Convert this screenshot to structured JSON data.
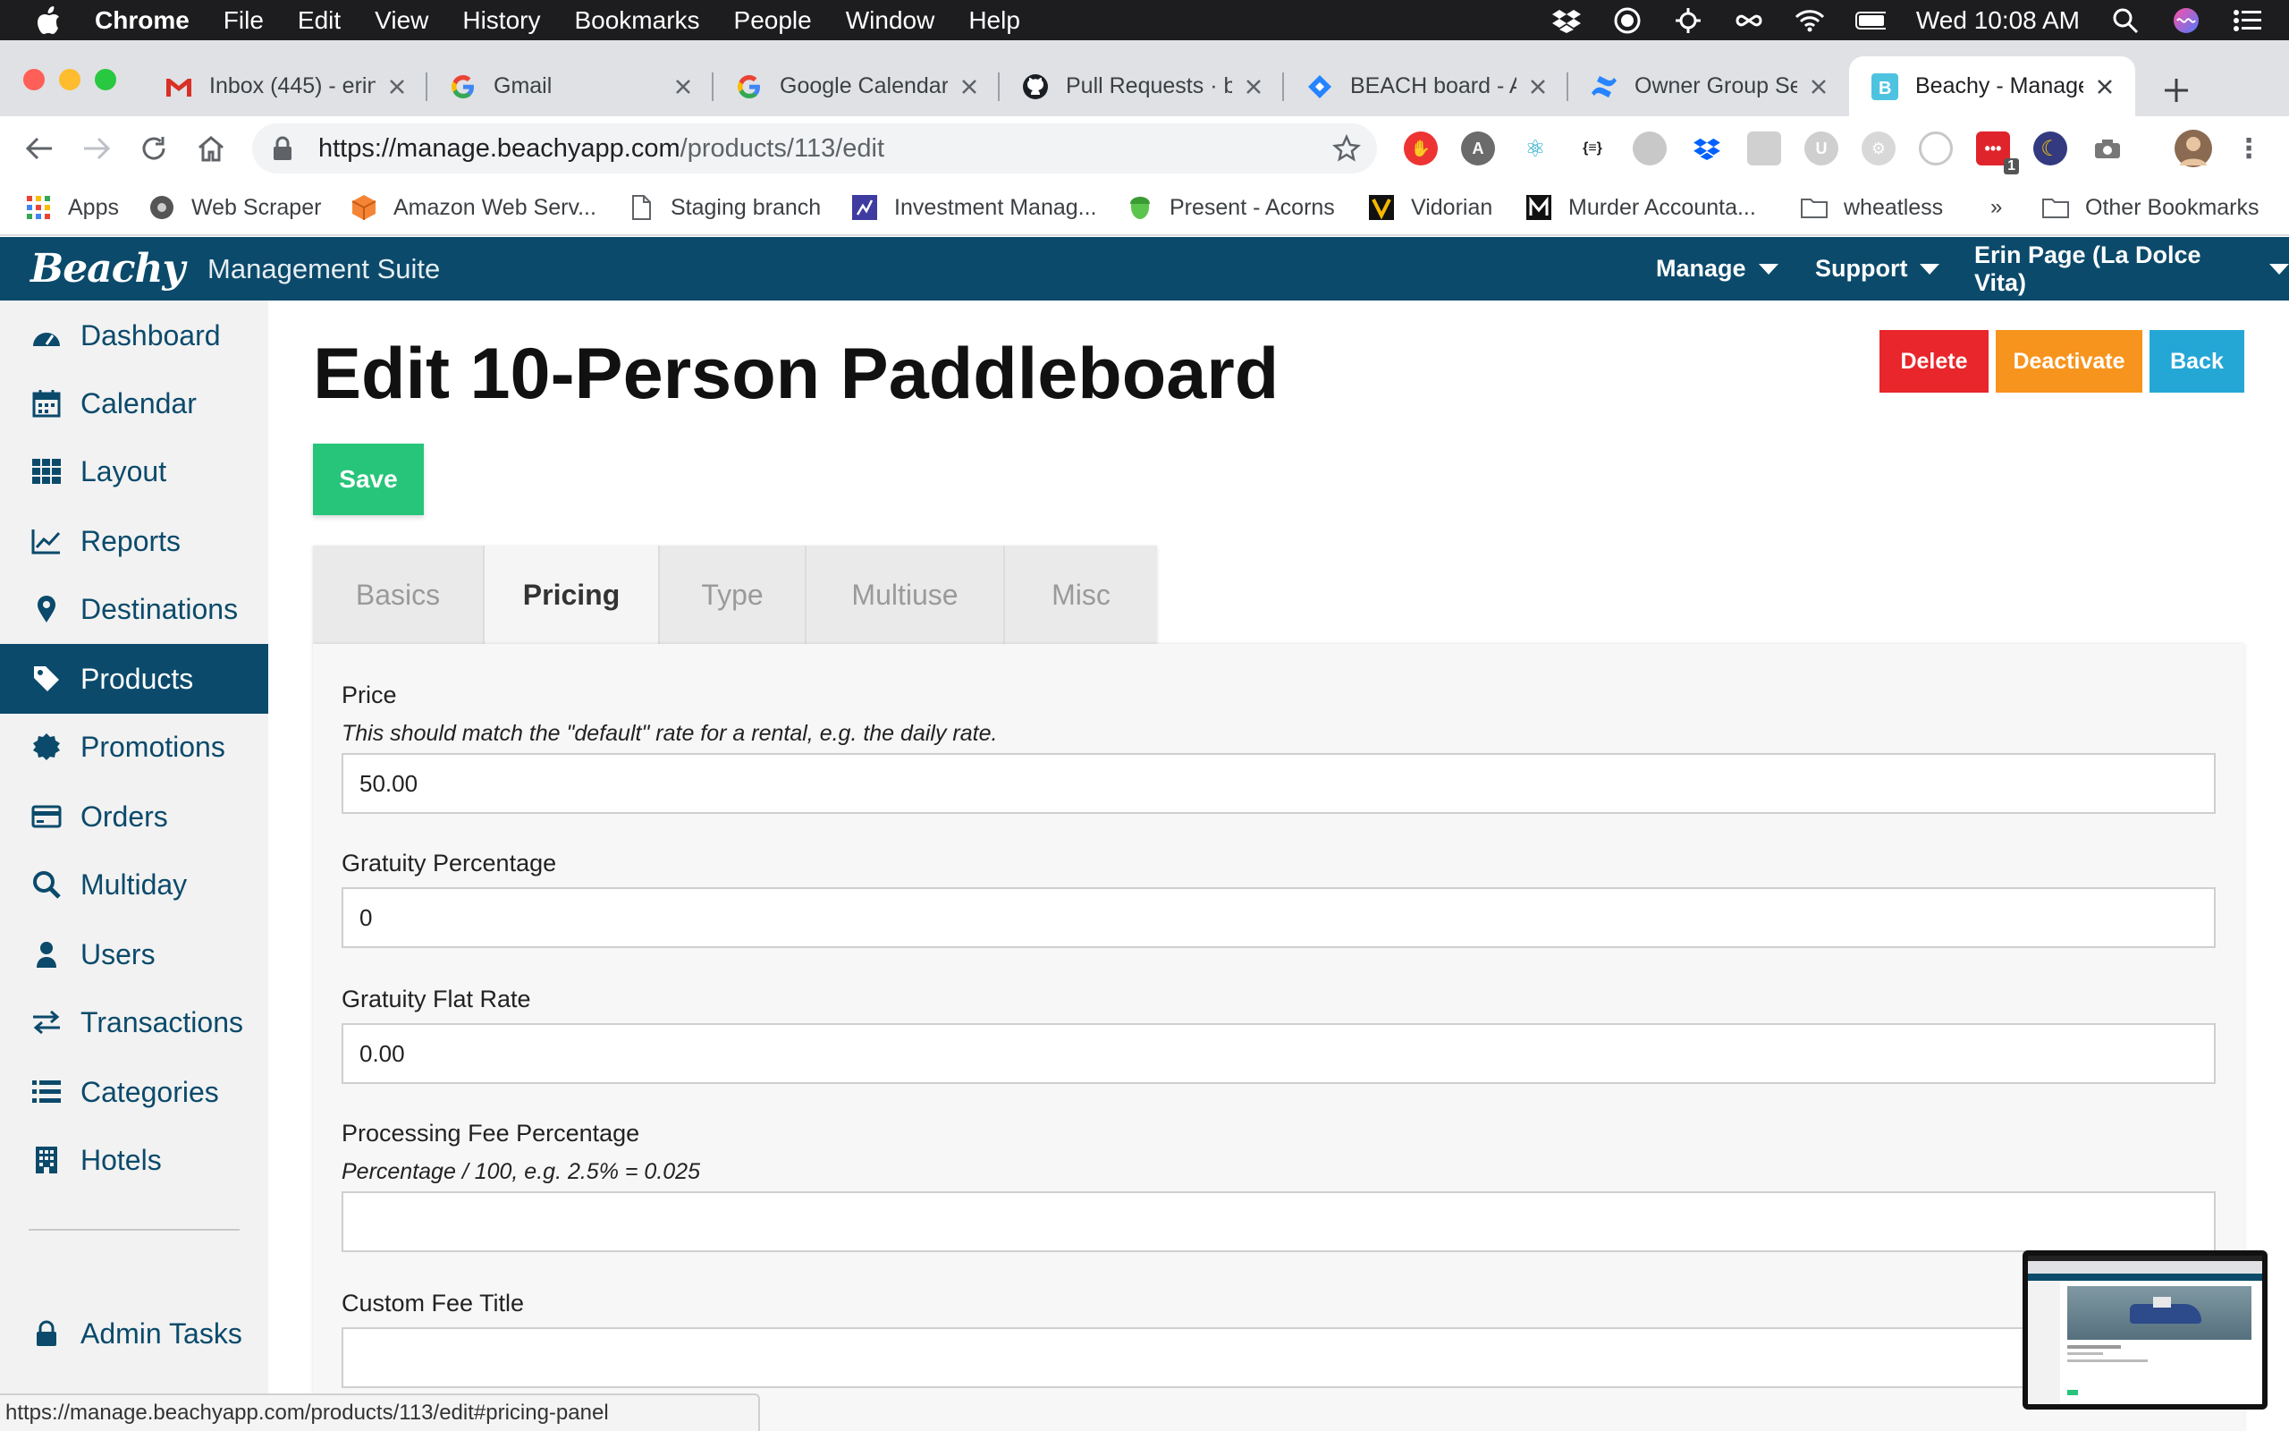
{
  "menubar": {
    "app": "Chrome",
    "items": [
      "File",
      "Edit",
      "View",
      "History",
      "Bookmarks",
      "People",
      "Window",
      "Help"
    ],
    "clock": "Wed 10:08 AM"
  },
  "tabs": [
    {
      "title": "Inbox (445) - erin",
      "icon": "gmail-icon"
    },
    {
      "title": "Gmail",
      "icon": "google-icon"
    },
    {
      "title": "Google Calendar",
      "icon": "google-icon"
    },
    {
      "title": "Pull Requests · b",
      "icon": "github-icon"
    },
    {
      "title": "BEACH board - A",
      "icon": "jira-icon"
    },
    {
      "title": "Owner Group Se",
      "icon": "confluence-icon"
    },
    {
      "title": "Beachy - Manage",
      "icon": "beachy-icon"
    }
  ],
  "address": {
    "host": "https://manage.beachyapp.com",
    "path": "/products/113/edit"
  },
  "bookmarks": [
    "Apps",
    "Web Scraper",
    "Amazon Web Serv...",
    "Staging branch",
    "Investment Manag...",
    "Present - Acorns",
    "Vidorian",
    "Murder Accounta...",
    "wheatless",
    "»",
    "Other Bookmarks"
  ],
  "extension_badge": "1",
  "app": {
    "logo": "Beachy",
    "suite": "Management Suite",
    "nav": [
      "Manage",
      "Support",
      "Erin Page (La Dolce Vita)"
    ]
  },
  "sidebar": {
    "items": [
      "Dashboard",
      "Calendar",
      "Layout",
      "Reports",
      "Destinations",
      "Products",
      "Promotions",
      "Orders",
      "Multiday",
      "Users",
      "Transactions",
      "Categories",
      "Hotels"
    ],
    "active": "Products",
    "admin": "Admin Tasks"
  },
  "page": {
    "title": "Edit 10-Person Paddleboard",
    "delete": "Delete",
    "deactivate": "Deactivate",
    "back": "Back",
    "save": "Save",
    "tabs": [
      "Basics",
      "Pricing",
      "Type",
      "Multiuse",
      "Misc"
    ],
    "active_tab": "Pricing"
  },
  "form": {
    "price_label": "Price",
    "price_help": "This should match the \"default\" rate for a rental, e.g. the daily rate.",
    "price_value": "50.00",
    "gratuity_pct_label": "Gratuity Percentage",
    "gratuity_pct_value": "0",
    "gratuity_flat_label": "Gratuity Flat Rate",
    "gratuity_flat_value": "0.00",
    "processing_label": "Processing Fee Percentage",
    "processing_help": "Percentage / 100, e.g. 2.5% = 0.025",
    "processing_value": "",
    "custom_fee_label": "Custom Fee Title",
    "custom_fee_value": ""
  },
  "status_url": "https://manage.beachyapp.com/products/113/edit#pricing-panel",
  "colors": {
    "brand": "#0b4a6b",
    "delete": "#e8262b",
    "deactivate": "#f7941d",
    "back": "#25a7d6",
    "save": "#27c57a"
  }
}
